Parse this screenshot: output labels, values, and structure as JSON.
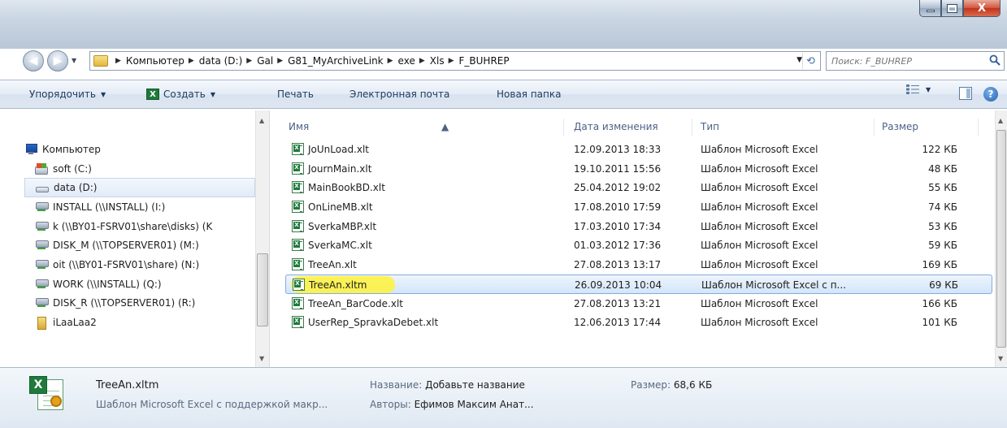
{
  "window": {
    "caption_buttons": [
      "minimize-icon",
      "maximize-icon",
      "close-icon"
    ],
    "close_glyph": "X"
  },
  "nav": {
    "back_icon": "back-arrow-icon",
    "forward_icon": "forward-arrow-icon",
    "breadcrumb": [
      "Компьютер",
      "data (D:)",
      "Gal",
      "G81_MyArchiveLink",
      "exe",
      "Xls",
      "F_BUHREP"
    ],
    "search_placeholder": "Поиск: F_BUHREP"
  },
  "toolbar": {
    "organize": "Упорядочить",
    "create": "Создать",
    "print": "Печать",
    "email": "Электронная почта",
    "new_folder": "Новая папка",
    "help": "?"
  },
  "sidebar": {
    "items": [
      {
        "label": "Компьютер",
        "icon": "computer-icon"
      },
      {
        "label": "soft (C:)",
        "icon": "drive-icon"
      },
      {
        "label": "data (D:)",
        "icon": "drive-icon",
        "selected": true
      },
      {
        "label": "INSTALL (\\\\INSTALL) (I:)",
        "icon": "network-drive-icon"
      },
      {
        "label": "k (\\\\BY01-FSRV01\\share\\disks) (K",
        "icon": "network-drive-icon"
      },
      {
        "label": "DISK_M (\\\\TOPSERVER01) (M:)",
        "icon": "network-drive-icon"
      },
      {
        "label": "oit (\\\\BY01-FSRV01\\share) (N:)",
        "icon": "network-drive-icon"
      },
      {
        "label": "WORK (\\\\INSTALL) (Q:)",
        "icon": "network-drive-icon"
      },
      {
        "label": "DISK_R (\\\\TOPSERVER01) (R:)",
        "icon": "network-drive-icon"
      },
      {
        "label": "iLaaLaa2",
        "icon": "user-folder-icon"
      }
    ]
  },
  "columns": {
    "name": "Имя",
    "date": "Дата изменения",
    "type": "Тип",
    "size": "Размер"
  },
  "files": [
    {
      "name": "JoUnLoad.xlt",
      "date": "12.09.2013 18:33",
      "type": "Шаблон Microsoft Excel",
      "size": "122 КБ"
    },
    {
      "name": "JournMain.xlt",
      "date": "19.10.2011 15:56",
      "type": "Шаблон Microsoft Excel",
      "size": "48 КБ"
    },
    {
      "name": "MainBookBD.xlt",
      "date": "25.04.2012 19:02",
      "type": "Шаблон Microsoft Excel",
      "size": "55 КБ"
    },
    {
      "name": "OnLineMB.xlt",
      "date": "17.08.2010 17:59",
      "type": "Шаблон Microsoft Excel",
      "size": "74 КБ"
    },
    {
      "name": "SverkaMBP.xlt",
      "date": "17.03.2010 17:34",
      "type": "Шаблон Microsoft Excel",
      "size": "53 КБ"
    },
    {
      "name": "SverkaMC.xlt",
      "date": "01.03.2012 17:36",
      "type": "Шаблон Microsoft Excel",
      "size": "59 КБ"
    },
    {
      "name": "TreeAn.xlt",
      "date": "27.08.2013 13:17",
      "type": "Шаблон Microsoft Excel",
      "size": "169 КБ"
    },
    {
      "name": "TreeAn.xltm",
      "date": "26.09.2013 10:04",
      "type": "Шаблон Microsoft Excel с п...",
      "size": "69 КБ",
      "selected": true
    },
    {
      "name": "TreeAn_BarCode.xlt",
      "date": "27.08.2013 13:21",
      "type": "Шаблон Microsoft Excel",
      "size": "166 КБ"
    },
    {
      "name": "UserRep_SpravkaDebet.xlt",
      "date": "12.06.2013 17:44",
      "type": "Шаблон Microsoft Excel",
      "size": "101 КБ"
    }
  ],
  "details": {
    "name": "TreeAn.xltm",
    "type": "Шаблон Microsoft Excel с поддержкой макр...",
    "title_label": "Название:",
    "title_value": "Добавьте название",
    "authors_label": "Авторы:",
    "authors_value": "Ефимов Максим Анат...",
    "size_label": "Размер:",
    "size_value": "68,6 КБ"
  },
  "colors": {
    "accent": "#1e3a5f",
    "selection": "#d3e5fa",
    "highlight": "#fff23a"
  }
}
